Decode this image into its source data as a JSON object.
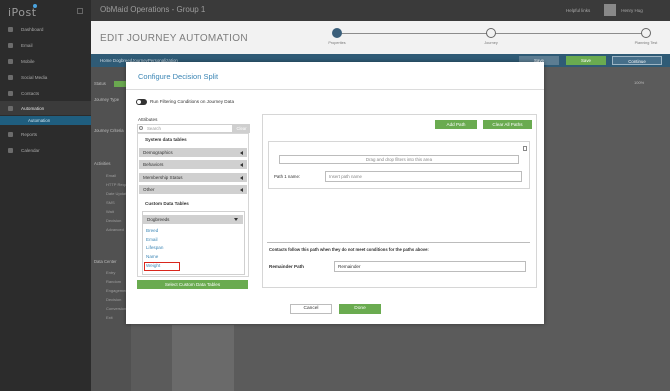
{
  "app": {
    "logo": "iPost",
    "org_title": "ObMaid Operations - Group 1",
    "user_link": "Helpful links",
    "user_name": "Henry Hug"
  },
  "sidebar": {
    "items": [
      {
        "label": "Dashboard",
        "icon": "dashboard-icon"
      },
      {
        "label": "Email",
        "icon": "email-icon"
      },
      {
        "label": "Mobile",
        "icon": "mobile-icon"
      },
      {
        "label": "Social Media",
        "icon": "social-icon"
      },
      {
        "label": "Contacts",
        "icon": "contacts-icon"
      },
      {
        "label": "Automation",
        "icon": "automation-icon"
      },
      {
        "label": "Reports",
        "icon": "reports-icon"
      },
      {
        "label": "Calendar",
        "icon": "calendar-icon"
      }
    ],
    "sub_item": "Automation"
  },
  "page": {
    "heading": "EDIT JOURNEY AUTOMATION",
    "steps": [
      "Properties",
      "Journey",
      "Planning Test"
    ],
    "breadcrumb": "Home  DogbreedJourneyPersonalization",
    "buttons": {
      "save": "Save",
      "save_exit": "Save",
      "continue": "Continue"
    },
    "zoom": "100%",
    "panel_labels": [
      "Status",
      "Journey Type",
      "Journey Criteria",
      "Activities",
      "Email",
      "HTTP Request",
      "Date Update",
      "SMS",
      "Wait",
      "Decision",
      "Advanced",
      "Data Center",
      "Entry",
      "Random",
      "Engagement",
      "Decision",
      "Conversion",
      "Exit"
    ]
  },
  "modal": {
    "title": "Configure Decision Split",
    "toggle_label": "Run Filtering Conditions on Journey Data",
    "attributes_title": "Attributes",
    "search_placeholder": "Search",
    "clear_label": "Clear",
    "system_tables_heading": "System data tables",
    "system_groups": [
      "Demographics",
      "Behaviors",
      "Membership Status",
      "Other"
    ],
    "custom_tables_heading": "Custom Data Tables",
    "custom_table": "Dogbreeds",
    "custom_fields": [
      "Breed",
      "Email",
      "Lifespan",
      "Name",
      "Weight"
    ],
    "highlighted_field": "Weight",
    "select_custom_button": "Select Custom Data Tables",
    "add_path_button": "Add Path",
    "clear_paths_button": "Clear All Paths",
    "drop_zone_text": "Drag and drop filters into this area",
    "path_label": "Path 1 name:",
    "path_placeholder": "Insert path name",
    "remainder_note": "Contacts follow this path when they do not meet conditions for the paths above:",
    "remainder_label": "Remainder Path",
    "remainder_value": "Remainder",
    "cancel_button": "Cancel",
    "done_button": "Done"
  },
  "colors": {
    "accent_blue": "#3c86b5",
    "action_green": "#6aab50",
    "highlight_red": "#d9261c",
    "nav_dark": "#2c2c2c",
    "action_bar": "#2f5b76"
  }
}
